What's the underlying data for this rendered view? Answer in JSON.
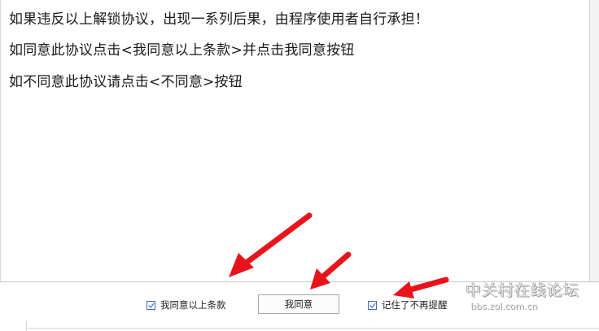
{
  "agreement": {
    "lines": [
      "如果违反以上解锁协议，出现一系列后果，由程序使用者自行承担！",
      "如同意此协议点击<我同意以上条款>并点击我同意按钮",
      "如不同意此协议请点击<不同意>按钮"
    ]
  },
  "footer": {
    "agree_terms_checkbox_label": "我同意以上条款",
    "agree_terms_checked": true,
    "agree_button_label": "我同意",
    "remember_checkbox_label": "记住了不再提醒",
    "remember_checked": true
  },
  "annotations": {
    "arrow_color": "#e8141c"
  },
  "watermark": {
    "brand": "中关村在线论坛",
    "url": "bbs.zol.com.cn"
  }
}
